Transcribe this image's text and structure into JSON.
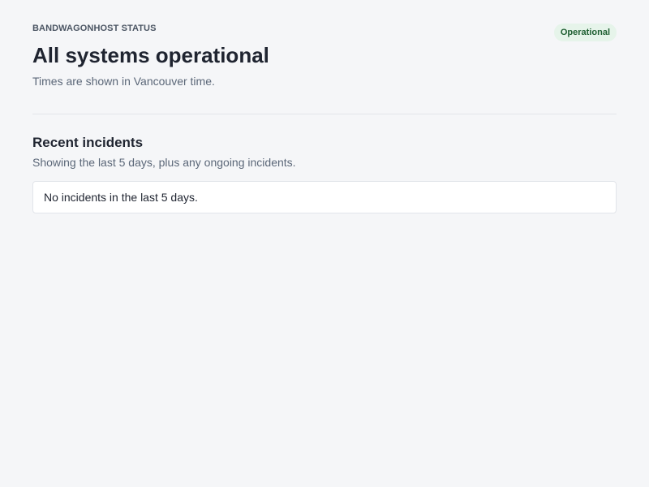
{
  "header": {
    "eyebrow": "BANDWAGONHOST STATUS",
    "title": "All systems operational",
    "subtitle": "Times are shown in Vancouver time.",
    "status_badge": "Operational"
  },
  "incidents": {
    "title": "Recent incidents",
    "subtitle": "Showing the last 5 days, plus any ongoing incidents.",
    "empty_message": "No incidents in the last 5 days."
  },
  "colors": {
    "background": "#f5f6f8",
    "badge_background": "#e6f4ea",
    "badge_text": "#1f5f32",
    "heading": "#1f2430",
    "muted_text": "#5b6778"
  }
}
